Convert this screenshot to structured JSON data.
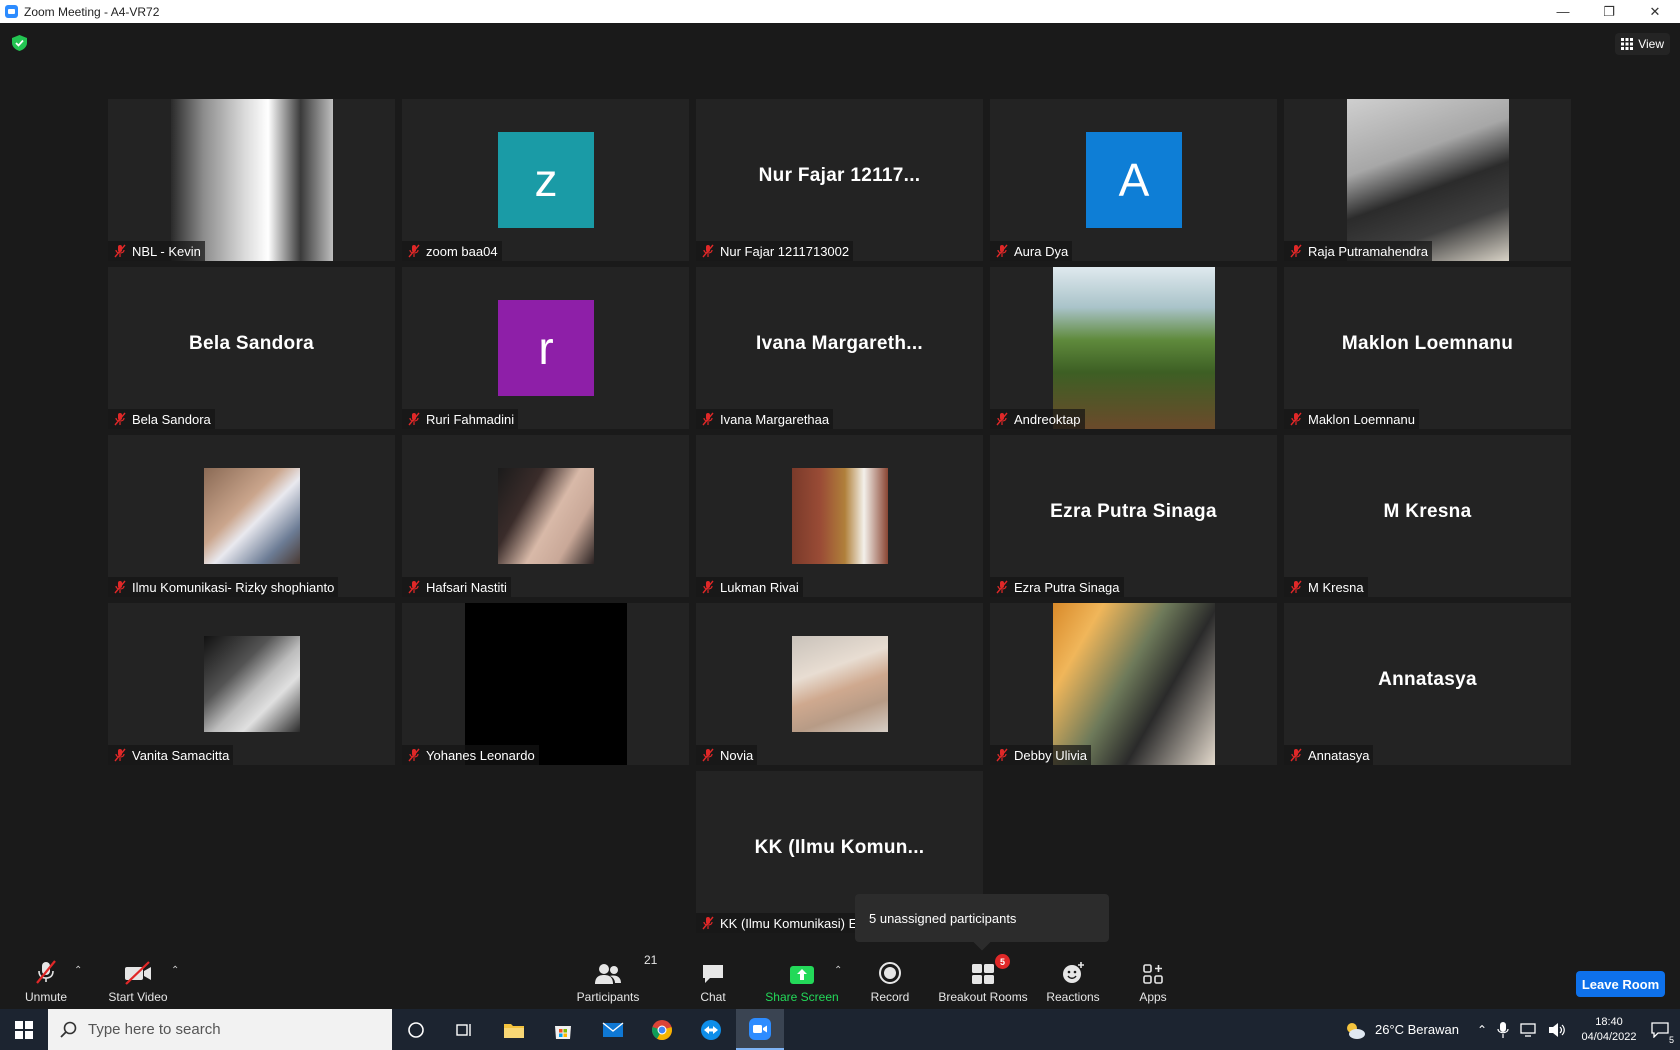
{
  "window": {
    "title": "Zoom Meeting - A4-VR72"
  },
  "header": {
    "view_label": "View"
  },
  "tiles": [
    {
      "name": "NBL - Kevin",
      "display": "photo",
      "photo": "bw-selfie"
    },
    {
      "name": "zoom baa04",
      "display": "avatar",
      "initial": "z",
      "color": "#1a9ba6"
    },
    {
      "name": "Nur Fajar 1211713002",
      "display": "name",
      "big_name": "Nur Fajar 12117..."
    },
    {
      "name": "Aura Dya",
      "display": "avatar",
      "initial": "A",
      "color": "#0e7ed6"
    },
    {
      "name": "Raja Putramahendra",
      "display": "photo",
      "photo": "man-reading"
    },
    {
      "name": "Bela Sandora",
      "display": "name",
      "big_name": "Bela Sandora"
    },
    {
      "name": "Ruri Fahmadini",
      "display": "avatar",
      "initial": "r",
      "color": "#8e1fa8"
    },
    {
      "name": "Ivana Margarethaa",
      "display": "name",
      "big_name": "Ivana Margareth..."
    },
    {
      "name": "Andreoktap",
      "display": "photo",
      "photo": "hill-landscape"
    },
    {
      "name": "Maklon Loemnanu",
      "display": "name",
      "big_name": "Maklon Loemnanu"
    },
    {
      "name": "Ilmu Komunikasi- Rizky shophianto",
      "display": "photo",
      "photo": "man-wall"
    },
    {
      "name": "Hafsari Nastiti",
      "display": "photo",
      "photo": "woman-portrait"
    },
    {
      "name": "Lukman Rivai",
      "display": "photo",
      "photo": "mirror-selfie"
    },
    {
      "name": "Ezra Putra Sinaga",
      "display": "name",
      "big_name": "Ezra Putra Sinaga"
    },
    {
      "name": "M Kresna",
      "display": "name",
      "big_name": "M Kresna"
    },
    {
      "name": "Vanita Samacitta",
      "display": "photo",
      "photo": "bw-portrait"
    },
    {
      "name": "Yohanes Leonardo",
      "display": "photo",
      "photo": "black"
    },
    {
      "name": "Novia",
      "display": "photo",
      "photo": "hijab-portrait"
    },
    {
      "name": "Debby Ulivia",
      "display": "photo",
      "photo": "cafe-woman"
    },
    {
      "name": "Annatasya",
      "display": "name",
      "big_name": "Annatasya"
    },
    {
      "name": "KK (Ilmu Komunikasi) Er",
      "display": "name",
      "big_name": "KK (Ilmu Komun..."
    }
  ],
  "tooltip": {
    "text": "5 unassigned participants"
  },
  "toolbar": {
    "unmute": "Unmute",
    "start_video": "Start Video",
    "participants": "Participants",
    "participants_count": "21",
    "chat": "Chat",
    "share_screen": "Share Screen",
    "record": "Record",
    "breakout_rooms": "Breakout Rooms",
    "breakout_badge": "5",
    "reactions": "Reactions",
    "apps": "Apps",
    "leave": "Leave Room"
  },
  "taskbar": {
    "search_placeholder": "Type here to search",
    "weather": "26°C  Berawan",
    "time": "18:40",
    "date": "04/04/2022",
    "notification_count": "5"
  },
  "colors": {
    "accent": "#0e71eb",
    "share": "#23d959",
    "mic_off": "#e02828"
  }
}
